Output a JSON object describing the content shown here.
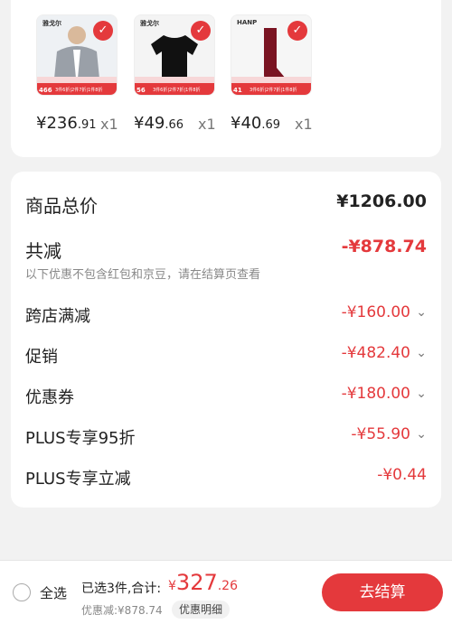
{
  "products": [
    {
      "brand": "雅戈尔",
      "count": "466",
      "promo": "3件6折|2件7折|1件8折",
      "price_int": "¥236",
      "price_dec": ".91",
      "qty": "x1",
      "colors": {
        "main": "#9aa0a8",
        "bg": "#eef1f4"
      }
    },
    {
      "brand": "雅戈尔",
      "count": "56",
      "promo": "3件6折|2件7折|1件8折",
      "price_int": "¥49",
      "price_dec": ".66",
      "qty": "x1",
      "colors": {
        "main": "#111111",
        "bg": "#f4f4f4"
      }
    },
    {
      "brand": "HANP",
      "count": "41",
      "promo": "3件6折|2件7折|1件8折",
      "price_int": "¥40",
      "price_dec": ".69",
      "qty": "x1",
      "colors": {
        "main": "#7a1422",
        "bg": "#f6f6f6"
      }
    }
  ],
  "summary": {
    "goods_total_label": "商品总价",
    "goods_total_value": "¥1206.00",
    "reduce_label": "共减",
    "reduce_value": "-¥878.74",
    "note": "以下优惠不包含红包和京豆，请在结算页查看",
    "rows": [
      {
        "label": "跨店满减",
        "value": "-¥160.00"
      },
      {
        "label": "促销",
        "value": "-¥482.40"
      },
      {
        "label": "优惠券",
        "value": "-¥180.00"
      },
      {
        "label": "PLUS专享95折",
        "value": "-¥55.90"
      },
      {
        "label": "PLUS专享立减",
        "value": "-¥0.44"
      }
    ]
  },
  "bottom": {
    "select_all": "全选",
    "selected": "已选3件,合计:",
    "total_cur": "¥",
    "total_int": "327",
    "total_dec": ".26",
    "discount": "优惠减:¥878.74",
    "detail_button": "优惠明细",
    "checkout": "去结算"
  },
  "accent": "#e4393c"
}
